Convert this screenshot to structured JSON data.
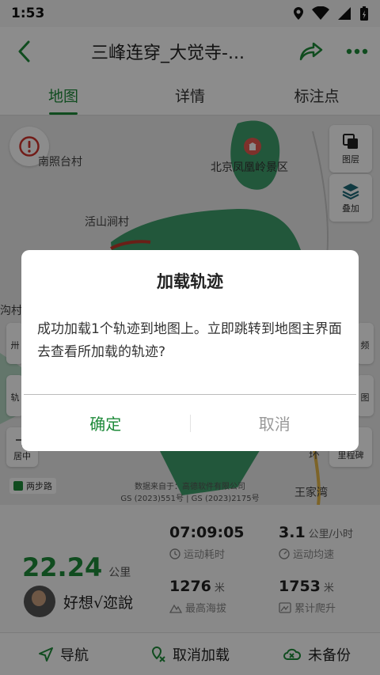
{
  "status": {
    "time": "1:53"
  },
  "header": {
    "title": "三峰连穿_大觉寺-..."
  },
  "tabs": [
    {
      "label": "地图",
      "active": true
    },
    {
      "label": "详情",
      "active": false
    },
    {
      "label": "标注点",
      "active": false
    }
  ],
  "map": {
    "labels": {
      "nanzhaotai": "南照台村",
      "fenghuangling": "北京凤凰岭景区",
      "huoshandong": "活山涧村",
      "goucun": "沟村",
      "wangjiawan": "王家湾",
      "huan": "环"
    },
    "controls": {
      "layers": "图层",
      "overlay": "叠加",
      "center": "居中",
      "milestone": "里程碑",
      "left_partial_1": "卅",
      "left_partial_2": "轨",
      "right_partial_1": "频",
      "right_partial_2": "图"
    },
    "walk_badge": "两步路",
    "copyright_line1": "数据来自于：高德软件有限公司",
    "copyright_line2": "GS (2023)551号 | GS (2023)2175号"
  },
  "stats": {
    "distance": "22.24",
    "distance_unit": "公里",
    "user_name": "好想√迩說",
    "duration": "07:09:05",
    "duration_label": "运动耗时",
    "avg_speed": "3.1",
    "avg_speed_unit": "公里/小时",
    "avg_speed_label": "运动均速",
    "max_alt": "1276",
    "max_alt_unit": "米",
    "max_alt_label": "最高海拔",
    "climb": "1753",
    "climb_unit": "米",
    "climb_label": "累计爬升"
  },
  "bottom_actions": {
    "navigate": "导航",
    "unload": "取消加载",
    "backup": "未备份"
  },
  "dialog": {
    "title": "加载轨迹",
    "message": "成功加载1个轨迹到地图上。立即跳转到地图主界面去查看所加载的轨迹?",
    "confirm": "确定",
    "cancel": "取消"
  },
  "colors": {
    "accent": "#1e8a3a",
    "map_green": "#3f9e6c",
    "track": "#c0392b"
  }
}
